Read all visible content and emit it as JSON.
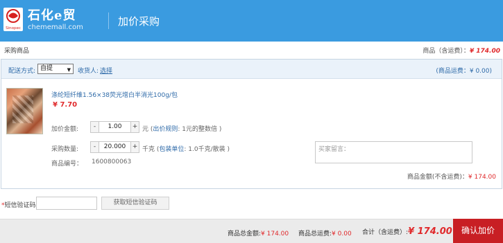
{
  "header": {
    "brand": "石化e贸",
    "domain": "chememall.com",
    "logo_text": "Sinopec",
    "title": "加价采购"
  },
  "section": {
    "title": "采购商品",
    "summary_label": "商品（含运费）：",
    "summary_value": "¥ 174.00"
  },
  "shipping": {
    "label": "配送方式:",
    "selected": "自提",
    "receiver_label": "收货人:",
    "receiver_link": "选择",
    "freight": "(商品运费：¥ 0.00)"
  },
  "product": {
    "name": "涤纶短纤维1.56×38荧光增白半消光100g/包",
    "price": "¥ 7.70",
    "markup_label": "加价金额:",
    "markup_value": "1.00",
    "markup_unit": "元 (",
    "markup_rule_link": "出价规则",
    "markup_rule_text": ": 1元的整数倍 )",
    "qty_label": "采购数量:",
    "qty_value": "20.000",
    "qty_unit": "千克 (",
    "qty_pack_link": "包装单位",
    "qty_pack_text": ": 1.0千克/散装 )",
    "code_label": "商品编号：",
    "code_value": "1600800063",
    "minus": "-",
    "plus": "+",
    "remark_placeholder": "买家留言：",
    "amount_label": "商品金额(不含运费)：",
    "amount_value": "¥ 174.00"
  },
  "sms": {
    "star": "*",
    "label": "短信验证码：",
    "button": "获取短信验证码"
  },
  "footer": {
    "total_label": "商品总金额:",
    "total_value": "¥ 174.00",
    "freight_label": "商品总运费:",
    "freight_value": "¥ 0.00",
    "sum_label": "合计（含运费）:",
    "sum_value": "¥ 174.00",
    "confirm": "确认加价"
  },
  "colors": {
    "header_bg": "#3a9be0",
    "accent_red": "#e0292b",
    "confirm_bg": "#c81f24",
    "link_blue": "#2e6aa8"
  }
}
